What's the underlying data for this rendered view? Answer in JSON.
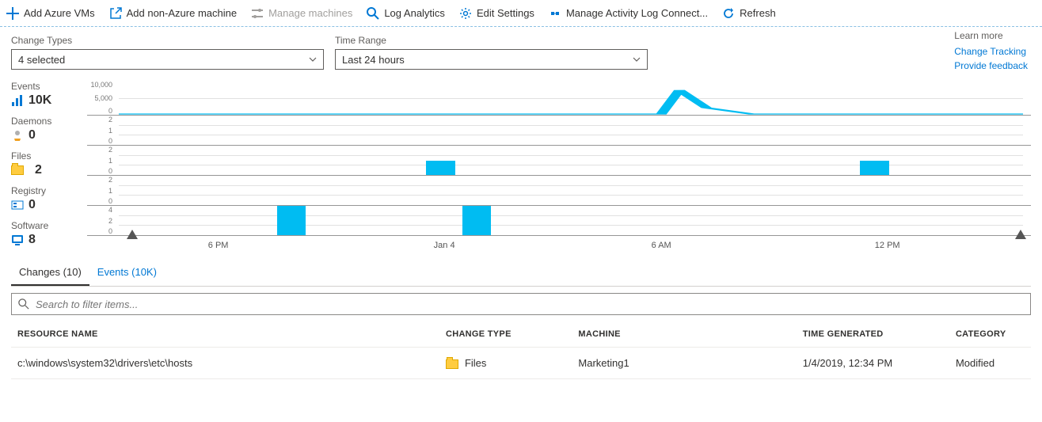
{
  "toolbar": {
    "add_vms": "Add Azure VMs",
    "add_non_azure": "Add non-Azure machine",
    "manage_machines": "Manage machines",
    "log_analytics": "Log Analytics",
    "edit_settings": "Edit Settings",
    "manage_activity": "Manage Activity Log Connect...",
    "refresh": "Refresh"
  },
  "filters": {
    "change_types_label": "Change Types",
    "change_types_value": "4 selected",
    "time_range_label": "Time Range",
    "time_range_value": "Last 24 hours"
  },
  "learn": {
    "header": "Learn more",
    "link1": "Change Tracking",
    "link2": "Provide feedback"
  },
  "stats": {
    "events": {
      "label": "Events",
      "value": "10K"
    },
    "daemons": {
      "label": "Daemons",
      "value": "0"
    },
    "files": {
      "label": "Files",
      "value": "2"
    },
    "registry": {
      "label": "Registry",
      "value": "0"
    },
    "software": {
      "label": "Software",
      "value": "8"
    }
  },
  "tabs": {
    "changes": "Changes (10)",
    "events": "Events (10K)"
  },
  "search_placeholder": "Search to filter items...",
  "columns": {
    "resource": "RESOURCE NAME",
    "change_type": "CHANGE TYPE",
    "machine": "MACHINE",
    "time": "TIME GENERATED",
    "category": "CATEGORY"
  },
  "rows": [
    {
      "resource": "c:\\windows\\system32\\drivers\\etc\\hosts",
      "change_type": "Files",
      "machine": "Marketing1",
      "time": "1/4/2019, 12:34 PM",
      "category": "Modified"
    }
  ],
  "chart_data": [
    {
      "type": "line",
      "name": "Events",
      "yticks": [
        "10,000",
        "5,000",
        "0"
      ],
      "ylim": [
        0,
        10000
      ],
      "x_ticks": [
        "6 PM",
        "Jan 4",
        "6 AM",
        "12 PM"
      ],
      "series": [
        {
          "name": "events",
          "values": [
            0,
            0,
            0,
            0,
            0,
            0,
            0,
            0,
            0,
            0,
            0,
            0,
            0,
            0,
            0,
            0,
            0,
            0,
            0,
            0,
            0,
            0,
            0,
            0,
            0,
            0,
            8000,
            2000,
            0,
            0,
            0,
            0,
            0,
            0,
            0,
            0,
            0,
            0,
            0,
            0,
            0,
            0
          ]
        }
      ]
    },
    {
      "type": "bar",
      "name": "Daemons",
      "yticks": [
        "2",
        "1",
        "0"
      ],
      "ylim": [
        0,
        2
      ],
      "bars": []
    },
    {
      "type": "bar",
      "name": "Files",
      "yticks": [
        "2",
        "1",
        "0"
      ],
      "ylim": [
        0,
        2
      ],
      "bars": [
        {
          "x_pct": 34,
          "w_pct": 3.2,
          "value": 1
        },
        {
          "x_pct": 82,
          "w_pct": 3.2,
          "value": 1
        }
      ]
    },
    {
      "type": "bar",
      "name": "Registry",
      "yticks": [
        "2",
        "1",
        "0"
      ],
      "ylim": [
        0,
        2
      ],
      "bars": []
    },
    {
      "type": "bar",
      "name": "Software",
      "yticks": [
        "4",
        "2",
        "0"
      ],
      "ylim": [
        0,
        4
      ],
      "bars": [
        {
          "x_pct": 17.5,
          "w_pct": 3.2,
          "value": 4
        },
        {
          "x_pct": 38,
          "w_pct": 3.2,
          "value": 4
        }
      ]
    }
  ]
}
